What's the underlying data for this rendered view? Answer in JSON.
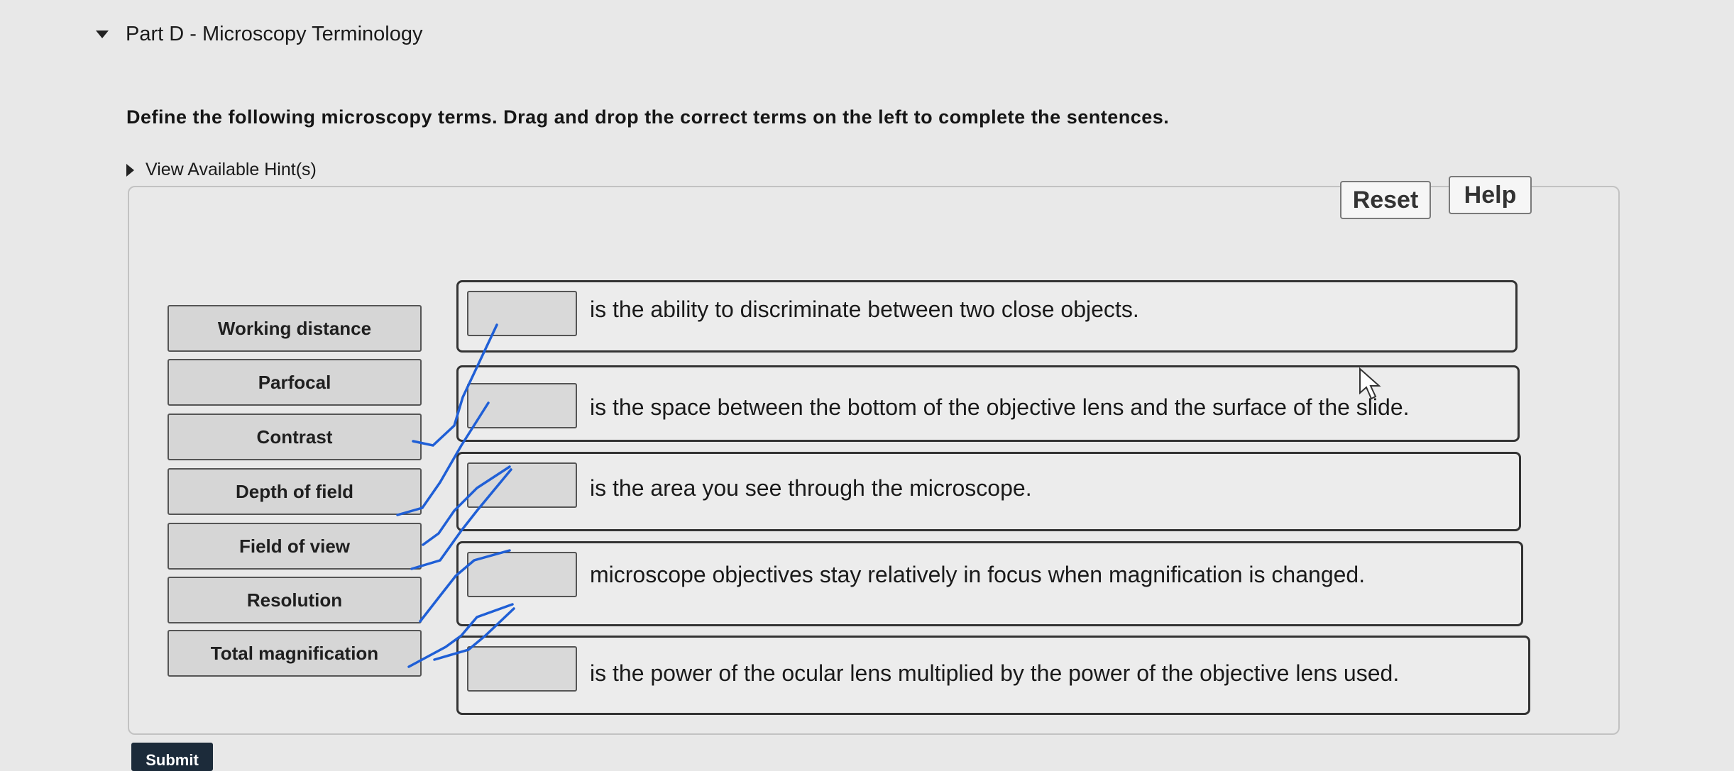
{
  "part": {
    "title": "Part D - Microscopy Terminology"
  },
  "instructions": "Define the following microscopy terms. Drag and drop the correct terms on the left to complete the sentences.",
  "hint": {
    "label": "View Available Hint(s)"
  },
  "buttons": {
    "reset": "Reset",
    "help": "Help",
    "submit": "Submit"
  },
  "terms": [
    "Working distance",
    "Parfocal",
    "Contrast",
    "Depth of field",
    "Field of view",
    "Resolution",
    "Total magnification"
  ],
  "sentences": [
    "is the ability to discriminate between two close objects.",
    "is the space between the bottom of the objective lens and the surface of the slide.",
    "is the area you see through the microscope.",
    "microscope objectives stay relatively in focus when magnification is changed.",
    "is the power of the ocular lens multiplied by the power of the objective lens used."
  ],
  "colors": {
    "pen": "#1f5fd6",
    "submit_bg": "#1c2b3a"
  }
}
